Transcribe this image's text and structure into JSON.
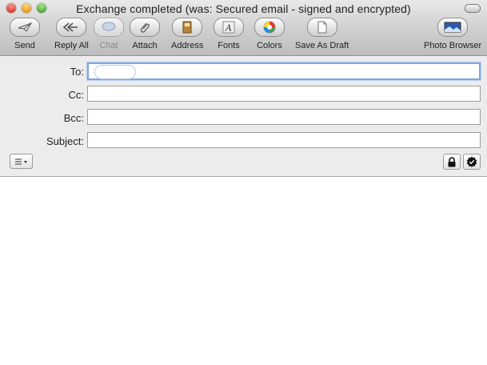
{
  "window": {
    "title": "Exchange completed (was: Secured email - signed and encrypted)"
  },
  "toolbar": {
    "items": [
      {
        "label": "Send",
        "icon": "send-icon",
        "enabled": true
      },
      {
        "label": "Reply All",
        "icon": "reply-all-icon",
        "enabled": true
      },
      {
        "label": "Chat",
        "icon": "chat-icon",
        "enabled": false
      },
      {
        "label": "Attach",
        "icon": "paperclip-icon",
        "enabled": true
      },
      {
        "label": "Address",
        "icon": "address-book-icon",
        "enabled": true
      },
      {
        "label": "Fonts",
        "icon": "fonts-icon",
        "enabled": true
      },
      {
        "label": "Colors",
        "icon": "color-wheel-icon",
        "enabled": true
      },
      {
        "label": "Save As Draft",
        "icon": "draft-icon",
        "enabled": true
      },
      {
        "label": "Photo Browser",
        "icon": "photo-icon",
        "enabled": true
      }
    ]
  },
  "header": {
    "to_label": "To:",
    "cc_label": "Cc:",
    "bcc_label": "Bcc:",
    "subject_label": "Subject:",
    "to_value": "",
    "cc_value": "",
    "bcc_value": "",
    "subject_value": ""
  },
  "format_menu_icon": "list-icon",
  "security": {
    "lock_icon": "lock-icon",
    "sign_icon": "signed-badge-icon"
  },
  "body_text": ""
}
